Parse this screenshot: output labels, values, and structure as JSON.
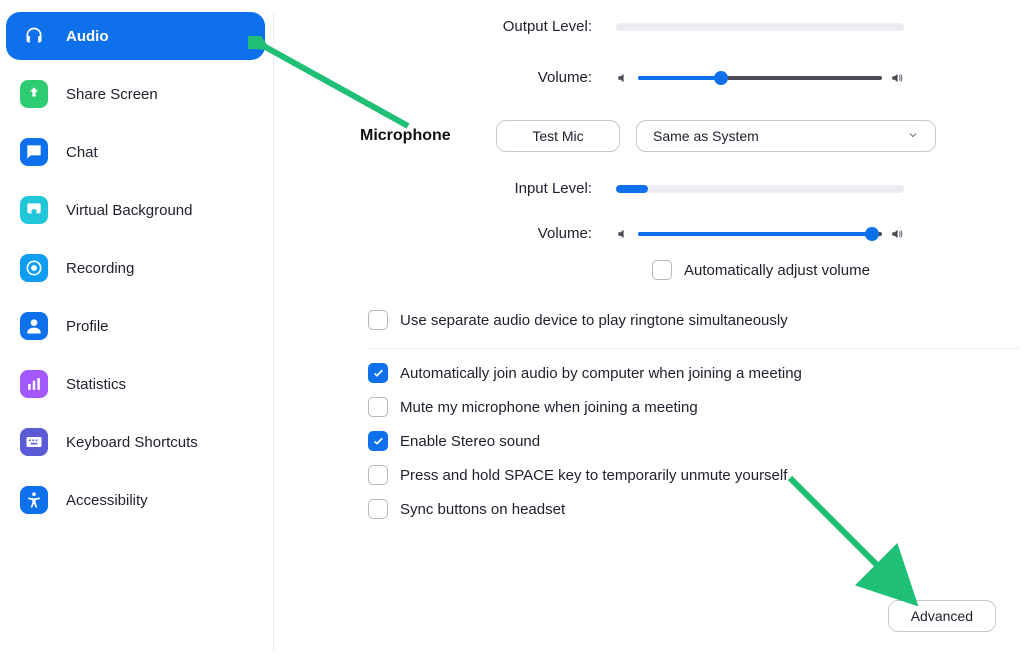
{
  "sidebar": {
    "items": [
      {
        "label": "Audio",
        "icon": "headphones-icon",
        "bg": "#0e71eb"
      },
      {
        "label": "Share Screen",
        "icon": "share-screen-icon",
        "bg": "#2ecc71"
      },
      {
        "label": "Chat",
        "icon": "chat-icon",
        "bg": "#0e71eb"
      },
      {
        "label": "Virtual Background",
        "icon": "virtual-background-icon",
        "bg": "#21c6d8"
      },
      {
        "label": "Recording",
        "icon": "record-icon",
        "bg": "#0e9df0"
      },
      {
        "label": "Profile",
        "icon": "profile-icon",
        "bg": "#0e71eb"
      },
      {
        "label": "Statistics",
        "icon": "statistics-icon",
        "bg": "#a259ff"
      },
      {
        "label": "Keyboard Shortcuts",
        "icon": "keyboard-icon",
        "bg": "#5b5bd6"
      },
      {
        "label": "Accessibility",
        "icon": "accessibility-icon",
        "bg": "#0e71eb"
      }
    ],
    "active_index": 0
  },
  "output": {
    "level_label": "Output Level:",
    "level_pct": 0,
    "volume_label": "Volume:",
    "volume_pct": 34
  },
  "microphone": {
    "section_label": "Microphone",
    "test_button": "Test Mic",
    "device_selected": "Same as System",
    "input_level_label": "Input Level:",
    "input_level_pct": 11,
    "volume_label": "Volume:",
    "volume_pct": 96,
    "auto_adjust_label": "Automatically adjust volume",
    "auto_adjust_checked": false
  },
  "options": {
    "separate_device": {
      "label": "Use separate audio device to play ringtone simultaneously",
      "checked": false
    },
    "auto_join": {
      "label": "Automatically join audio by computer when joining a meeting",
      "checked": true
    },
    "mute_on_join": {
      "label": "Mute my microphone when joining a meeting",
      "checked": false
    },
    "stereo": {
      "label": "Enable Stereo sound",
      "checked": true
    },
    "push_to_talk": {
      "label": "Press and hold SPACE key to temporarily unmute yourself",
      "checked": false
    },
    "sync_headset": {
      "label": "Sync buttons on headset",
      "checked": false
    }
  },
  "advanced_button": "Advanced"
}
